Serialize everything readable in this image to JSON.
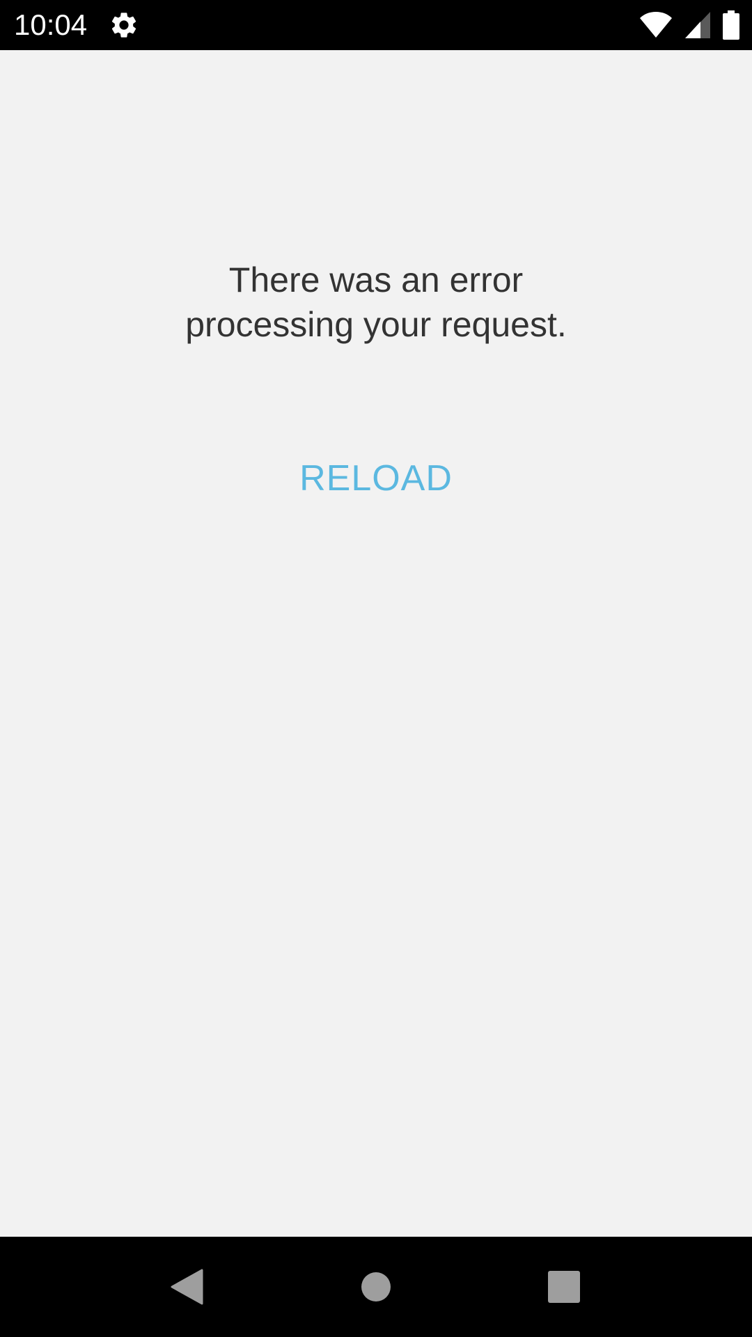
{
  "status_bar": {
    "time": "10:04",
    "icons": [
      "gear-icon",
      "wifi-icon",
      "cell-signal-icon",
      "battery-icon"
    ]
  },
  "error": {
    "line1": "There was an error",
    "line2": "processing your request."
  },
  "reload": {
    "label": "RELOAD"
  },
  "nav_bar": {
    "icons": [
      "back-icon",
      "home-icon",
      "recents-icon"
    ]
  },
  "colors": {
    "background": "#f2f2f2",
    "text": "#333333",
    "accent": "#5bb8e0",
    "bars": "#000000",
    "nav_icons": "#9e9e9e"
  }
}
